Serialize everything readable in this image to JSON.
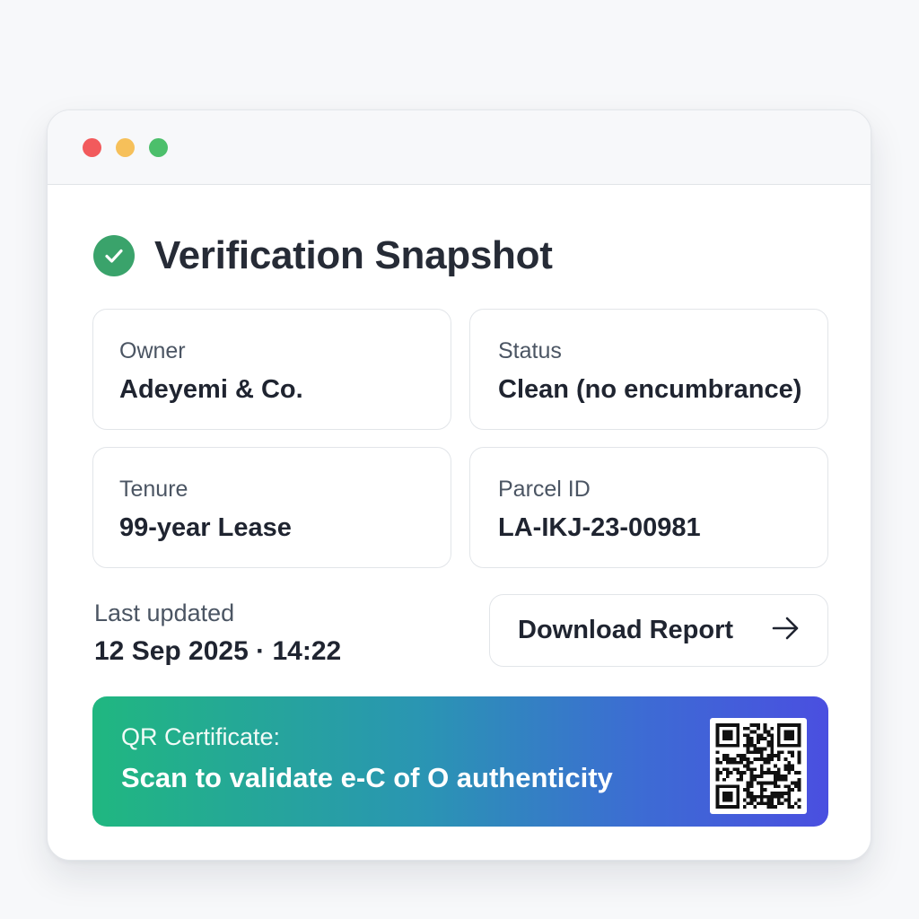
{
  "title": "Verification Snapshot",
  "fields": [
    {
      "label": "Owner",
      "value": "Adeyemi & Co."
    },
    {
      "label": "Status",
      "value": "Clean (no encumbrance)"
    },
    {
      "label": "Tenure",
      "value": "99-year Lease"
    },
    {
      "label": "Parcel ID",
      "value": "LA-IKJ-23-00981"
    }
  ],
  "updated": {
    "label": "Last updated",
    "value": "12 Sep 2025 · 14:22"
  },
  "download": {
    "label": "Download Report",
    "icon": "arrow-right-icon"
  },
  "qr": {
    "line1": "QR Certificate:",
    "line2": "Scan to validate e-C of O authenticity",
    "icon": "qr-code-icon"
  },
  "colors": {
    "check": "#3aa36b",
    "gradient_start": "#20b780",
    "gradient_end": "#4a4fe0",
    "window_close": "#f25a5c",
    "window_minimize": "#f6c05a",
    "window_maximize": "#4cbf6b"
  }
}
